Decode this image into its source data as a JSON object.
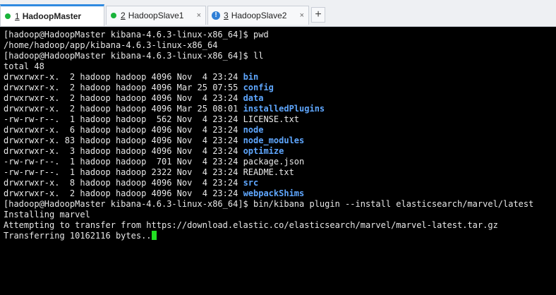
{
  "tabs": [
    {
      "num": "1",
      "label": "HadoopMaster",
      "status": "connected",
      "active": true
    },
    {
      "num": "2",
      "label": "HadoopSlave1",
      "status": "connected",
      "active": false
    },
    {
      "num": "3",
      "label": "HadoopSlave2",
      "status": "warning",
      "active": false
    }
  ],
  "tab_close_glyph": "×",
  "add_tab_glyph": "+",
  "warning_glyph": "!",
  "colors": {
    "connected_dot": "#19b33a",
    "warning_dot": "#2f7fd6",
    "directory": "#5fa7ff",
    "cursor": "#22e022"
  },
  "terminal": {
    "lines": [
      {
        "text": "[hadoop@HadoopMaster kibana-4.6.3-linux-x86_64]$ pwd"
      },
      {
        "text": "/home/hadoop/app/kibana-4.6.3-linux-x86_64"
      },
      {
        "text": "[hadoop@HadoopMaster kibana-4.6.3-linux-x86_64]$ ll"
      },
      {
        "text": "total 48"
      },
      {
        "text": "drwxrwxr-x.  2 hadoop hadoop 4096 Nov  4 23:24 ",
        "name": "bin",
        "dir": true
      },
      {
        "text": "drwxrwxr-x.  2 hadoop hadoop 4096 Mar 25 07:55 ",
        "name": "config",
        "dir": true
      },
      {
        "text": "drwxrwxr-x.  2 hadoop hadoop 4096 Nov  4 23:24 ",
        "name": "data",
        "dir": true
      },
      {
        "text": "drwxrwxr-x.  2 hadoop hadoop 4096 Mar 25 08:01 ",
        "name": "installedPlugins",
        "dir": true
      },
      {
        "text": "-rw-rw-r--.  1 hadoop hadoop  562 Nov  4 23:24 ",
        "name": "LICENSE.txt",
        "dir": false
      },
      {
        "text": "drwxrwxr-x.  6 hadoop hadoop 4096 Nov  4 23:24 ",
        "name": "node",
        "dir": true
      },
      {
        "text": "drwxrwxr-x. 83 hadoop hadoop 4096 Nov  4 23:24 ",
        "name": "node_modules",
        "dir": true
      },
      {
        "text": "drwxrwxr-x.  3 hadoop hadoop 4096 Nov  4 23:24 ",
        "name": "optimize",
        "dir": true
      },
      {
        "text": "-rw-rw-r--.  1 hadoop hadoop  701 Nov  4 23:24 ",
        "name": "package.json",
        "dir": false
      },
      {
        "text": "-rw-rw-r--.  1 hadoop hadoop 2322 Nov  4 23:24 ",
        "name": "README.txt",
        "dir": false
      },
      {
        "text": "drwxrwxr-x.  8 hadoop hadoop 4096 Nov  4 23:24 ",
        "name": "src",
        "dir": true
      },
      {
        "text": "drwxrwxr-x.  2 hadoop hadoop 4096 Nov  4 23:24 ",
        "name": "webpackShims",
        "dir": true
      },
      {
        "text": "[hadoop@HadoopMaster kibana-4.6.3-linux-x86_64]$ bin/kibana plugin --install elasticsearch/marvel/latest"
      },
      {
        "text": "Installing marvel"
      },
      {
        "text": "Attempting to transfer from https://download.elastic.co/elasticsearch/marvel/marvel-latest.tar.gz"
      },
      {
        "text": "Transferring 10162116 bytes..",
        "cursor": true
      }
    ]
  }
}
